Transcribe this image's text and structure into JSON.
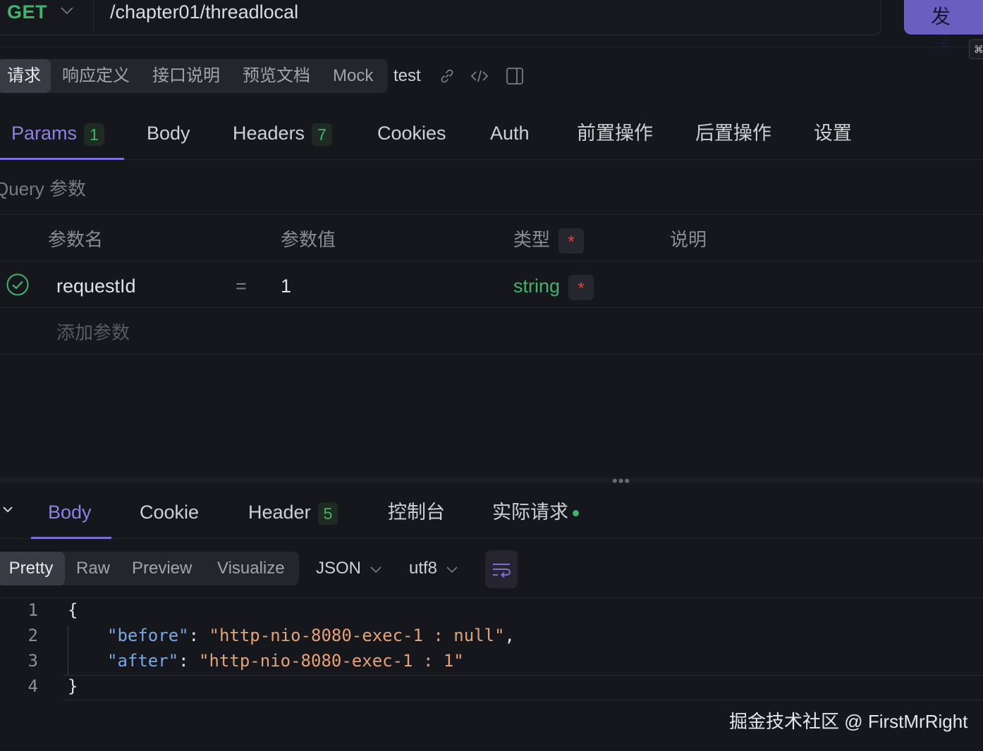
{
  "request": {
    "method": "GET",
    "url": "/chapter01/threadlocal",
    "send_label": "发 送",
    "shortcut_key": "⌘"
  },
  "top_tabs": {
    "items": [
      "请求",
      "响应定义",
      "接口说明",
      "预览文档",
      "Mock"
    ],
    "active": "请求",
    "extra_label": "test",
    "icons": [
      "link-icon",
      "code-icon",
      "split-panel-icon"
    ]
  },
  "params_tabs": {
    "items": [
      {
        "label": "Params",
        "badge": "1"
      },
      {
        "label": "Body"
      },
      {
        "label": "Headers",
        "badge": "7"
      },
      {
        "label": "Cookies"
      },
      {
        "label": "Auth"
      },
      {
        "label": "前置操作"
      },
      {
        "label": "后置操作"
      },
      {
        "label": "设置"
      }
    ],
    "active": "Params"
  },
  "query": {
    "title": "Query 参数",
    "headers": {
      "name": "参数名",
      "value": "参数值",
      "type": "类型",
      "desc": "说明"
    },
    "required_mark": "*",
    "rows": [
      {
        "name": "requestId",
        "eq": "=",
        "value": "1",
        "type": "string",
        "required": "*",
        "enabled": true
      }
    ],
    "add_placeholder": "添加参数"
  },
  "splitter": {
    "dots": "•••"
  },
  "response_tabs": {
    "items": [
      {
        "label": "Body"
      },
      {
        "label": "Cookie"
      },
      {
        "label": "Header",
        "badge": "5"
      },
      {
        "label": "控制台"
      },
      {
        "label": "实际请求"
      }
    ],
    "active": "Body"
  },
  "format_bar": {
    "modes": [
      "Pretty",
      "Raw",
      "Preview",
      "Visualize"
    ],
    "active": "Pretty",
    "format": "JSON",
    "encoding": "utf8"
  },
  "code": {
    "line_numbers": [
      "1",
      "2",
      "3",
      "4"
    ],
    "open": "{",
    "close": "}",
    "entries": [
      {
        "key": "\"before\"",
        "value": "\"http-nio-8080-exec-1 : null\"",
        "trail": ","
      },
      {
        "key": "\"after\"",
        "value": "\"http-nio-8080-exec-1 : 1\"",
        "trail": ""
      }
    ]
  },
  "watermark": "掘金技术社区 @ FirstMrRight",
  "colors": {
    "background": "#16171d",
    "accent": "#7a6fd6",
    "send_button": "#6a5fc0",
    "success_green": "#3fb46a",
    "required_red": "#e0453b"
  }
}
